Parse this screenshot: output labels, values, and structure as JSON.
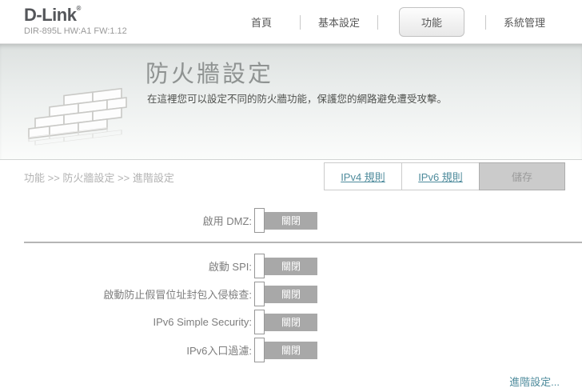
{
  "header": {
    "logo": "D-Link",
    "logo_registered_mark": "®",
    "model": "DIR-895L HW:A1 FW:1.12",
    "nav": [
      {
        "label": "首頁",
        "active": false
      },
      {
        "label": "基本設定",
        "active": false
      },
      {
        "label": "功能",
        "active": true
      },
      {
        "label": "系統管理",
        "active": false
      }
    ]
  },
  "banner": {
    "title": "防火牆設定",
    "subtitle": "在這裡您可以設定不同的防火牆功能，保護您的網路避免遭受攻擊。",
    "icon": "brick-wall-icon"
  },
  "toolbar": {
    "breadcrumb": "功能 >> 防火牆設定 >> 進階設定",
    "ipv4_button": "IPv4 規則",
    "ipv6_button": "IPv6 規則",
    "save_button": "儲存"
  },
  "form": {
    "dmz_row": {
      "label": "啟用 DMZ:",
      "toggle": "關閉",
      "state": "off"
    },
    "rows": [
      {
        "label": "啟動 SPI:",
        "toggle": "關閉",
        "state": "off"
      },
      {
        "label": "啟動防止假冒位址封包入侵檢查:",
        "toggle": "關閉",
        "state": "off"
      },
      {
        "label": "IPv6 Simple Security:",
        "toggle": "關閉",
        "state": "off"
      },
      {
        "label": "IPv6入口過濾:",
        "toggle": "關閉",
        "state": "off"
      }
    ],
    "advanced_link": "進階設定..."
  },
  "colors": {
    "link_teal": "#4e8b9c",
    "toggle_bar_gray": "#a8a8a8",
    "save_button_gray": "#cbcbcb",
    "logo_gray": "#54565a"
  }
}
